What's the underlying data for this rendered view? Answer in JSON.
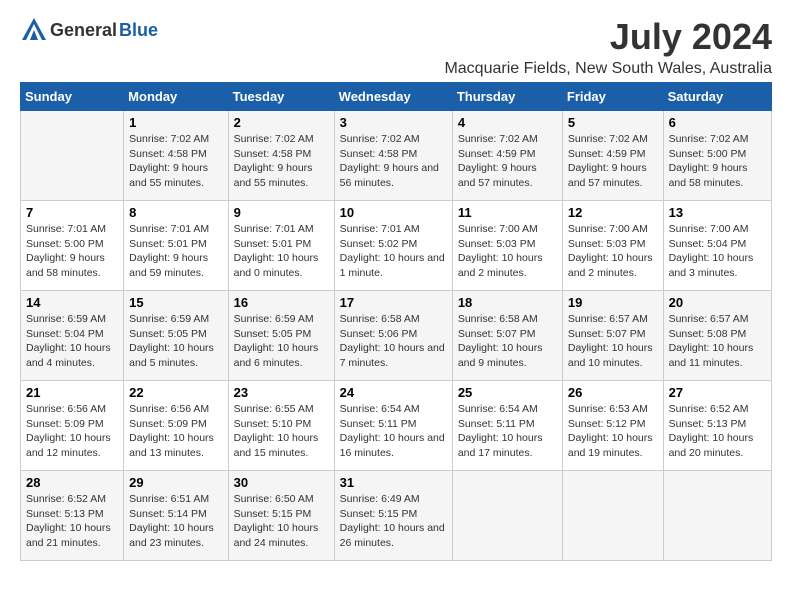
{
  "logo": {
    "general": "General",
    "blue": "Blue"
  },
  "title": "July 2024",
  "subtitle": "Macquarie Fields, New South Wales, Australia",
  "days_header": [
    "Sunday",
    "Monday",
    "Tuesday",
    "Wednesday",
    "Thursday",
    "Friday",
    "Saturday"
  ],
  "weeks": [
    [
      {
        "day": "",
        "sunrise": "",
        "sunset": "",
        "daylight": ""
      },
      {
        "day": "1",
        "sunrise": "Sunrise: 7:02 AM",
        "sunset": "Sunset: 4:58 PM",
        "daylight": "Daylight: 9 hours and 55 minutes."
      },
      {
        "day": "2",
        "sunrise": "Sunrise: 7:02 AM",
        "sunset": "Sunset: 4:58 PM",
        "daylight": "Daylight: 9 hours and 55 minutes."
      },
      {
        "day": "3",
        "sunrise": "Sunrise: 7:02 AM",
        "sunset": "Sunset: 4:58 PM",
        "daylight": "Daylight: 9 hours and 56 minutes."
      },
      {
        "day": "4",
        "sunrise": "Sunrise: 7:02 AM",
        "sunset": "Sunset: 4:59 PM",
        "daylight": "Daylight: 9 hours and 57 minutes."
      },
      {
        "day": "5",
        "sunrise": "Sunrise: 7:02 AM",
        "sunset": "Sunset: 4:59 PM",
        "daylight": "Daylight: 9 hours and 57 minutes."
      },
      {
        "day": "6",
        "sunrise": "Sunrise: 7:02 AM",
        "sunset": "Sunset: 5:00 PM",
        "daylight": "Daylight: 9 hours and 58 minutes."
      }
    ],
    [
      {
        "day": "7",
        "sunrise": "Sunrise: 7:01 AM",
        "sunset": "Sunset: 5:00 PM",
        "daylight": "Daylight: 9 hours and 58 minutes."
      },
      {
        "day": "8",
        "sunrise": "Sunrise: 7:01 AM",
        "sunset": "Sunset: 5:01 PM",
        "daylight": "Daylight: 9 hours and 59 minutes."
      },
      {
        "day": "9",
        "sunrise": "Sunrise: 7:01 AM",
        "sunset": "Sunset: 5:01 PM",
        "daylight": "Daylight: 10 hours and 0 minutes."
      },
      {
        "day": "10",
        "sunrise": "Sunrise: 7:01 AM",
        "sunset": "Sunset: 5:02 PM",
        "daylight": "Daylight: 10 hours and 1 minute."
      },
      {
        "day": "11",
        "sunrise": "Sunrise: 7:00 AM",
        "sunset": "Sunset: 5:03 PM",
        "daylight": "Daylight: 10 hours and 2 minutes."
      },
      {
        "day": "12",
        "sunrise": "Sunrise: 7:00 AM",
        "sunset": "Sunset: 5:03 PM",
        "daylight": "Daylight: 10 hours and 2 minutes."
      },
      {
        "day": "13",
        "sunrise": "Sunrise: 7:00 AM",
        "sunset": "Sunset: 5:04 PM",
        "daylight": "Daylight: 10 hours and 3 minutes."
      }
    ],
    [
      {
        "day": "14",
        "sunrise": "Sunrise: 6:59 AM",
        "sunset": "Sunset: 5:04 PM",
        "daylight": "Daylight: 10 hours and 4 minutes."
      },
      {
        "day": "15",
        "sunrise": "Sunrise: 6:59 AM",
        "sunset": "Sunset: 5:05 PM",
        "daylight": "Daylight: 10 hours and 5 minutes."
      },
      {
        "day": "16",
        "sunrise": "Sunrise: 6:59 AM",
        "sunset": "Sunset: 5:05 PM",
        "daylight": "Daylight: 10 hours and 6 minutes."
      },
      {
        "day": "17",
        "sunrise": "Sunrise: 6:58 AM",
        "sunset": "Sunset: 5:06 PM",
        "daylight": "Daylight: 10 hours and 7 minutes."
      },
      {
        "day": "18",
        "sunrise": "Sunrise: 6:58 AM",
        "sunset": "Sunset: 5:07 PM",
        "daylight": "Daylight: 10 hours and 9 minutes."
      },
      {
        "day": "19",
        "sunrise": "Sunrise: 6:57 AM",
        "sunset": "Sunset: 5:07 PM",
        "daylight": "Daylight: 10 hours and 10 minutes."
      },
      {
        "day": "20",
        "sunrise": "Sunrise: 6:57 AM",
        "sunset": "Sunset: 5:08 PM",
        "daylight": "Daylight: 10 hours and 11 minutes."
      }
    ],
    [
      {
        "day": "21",
        "sunrise": "Sunrise: 6:56 AM",
        "sunset": "Sunset: 5:09 PM",
        "daylight": "Daylight: 10 hours and 12 minutes."
      },
      {
        "day": "22",
        "sunrise": "Sunrise: 6:56 AM",
        "sunset": "Sunset: 5:09 PM",
        "daylight": "Daylight: 10 hours and 13 minutes."
      },
      {
        "day": "23",
        "sunrise": "Sunrise: 6:55 AM",
        "sunset": "Sunset: 5:10 PM",
        "daylight": "Daylight: 10 hours and 15 minutes."
      },
      {
        "day": "24",
        "sunrise": "Sunrise: 6:54 AM",
        "sunset": "Sunset: 5:11 PM",
        "daylight": "Daylight: 10 hours and 16 minutes."
      },
      {
        "day": "25",
        "sunrise": "Sunrise: 6:54 AM",
        "sunset": "Sunset: 5:11 PM",
        "daylight": "Daylight: 10 hours and 17 minutes."
      },
      {
        "day": "26",
        "sunrise": "Sunrise: 6:53 AM",
        "sunset": "Sunset: 5:12 PM",
        "daylight": "Daylight: 10 hours and 19 minutes."
      },
      {
        "day": "27",
        "sunrise": "Sunrise: 6:52 AM",
        "sunset": "Sunset: 5:13 PM",
        "daylight": "Daylight: 10 hours and 20 minutes."
      }
    ],
    [
      {
        "day": "28",
        "sunrise": "Sunrise: 6:52 AM",
        "sunset": "Sunset: 5:13 PM",
        "daylight": "Daylight: 10 hours and 21 minutes."
      },
      {
        "day": "29",
        "sunrise": "Sunrise: 6:51 AM",
        "sunset": "Sunset: 5:14 PM",
        "daylight": "Daylight: 10 hours and 23 minutes."
      },
      {
        "day": "30",
        "sunrise": "Sunrise: 6:50 AM",
        "sunset": "Sunset: 5:15 PM",
        "daylight": "Daylight: 10 hours and 24 minutes."
      },
      {
        "day": "31",
        "sunrise": "Sunrise: 6:49 AM",
        "sunset": "Sunset: 5:15 PM",
        "daylight": "Daylight: 10 hours and 26 minutes."
      },
      {
        "day": "",
        "sunrise": "",
        "sunset": "",
        "daylight": ""
      },
      {
        "day": "",
        "sunrise": "",
        "sunset": "",
        "daylight": ""
      },
      {
        "day": "",
        "sunrise": "",
        "sunset": "",
        "daylight": ""
      }
    ]
  ]
}
